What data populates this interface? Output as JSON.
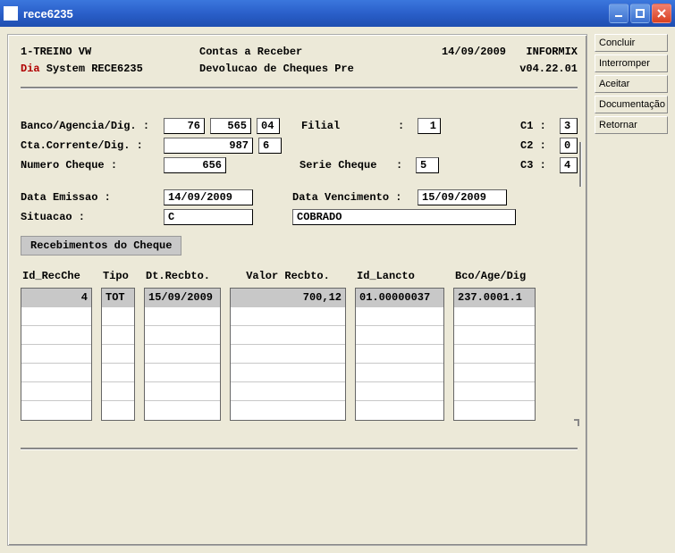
{
  "window": {
    "title": "rece6235"
  },
  "sideButtons": {
    "concluir": "Concluir",
    "interromper": "Interromper",
    "aceitar": "Aceitar",
    "documentacao": "Documentação",
    "retornar": "Retornar"
  },
  "header": {
    "line1_left": "1-TREINO VW",
    "line1_mid": "Contas a Receber",
    "line1_date": "14/09/2009",
    "line1_right": "INFORMIX",
    "dia": "Dia",
    "system_prog": " System  RECE6235",
    "line2_mid": "Devolucao de Cheques Pre",
    "version": "v04.22.01"
  },
  "form": {
    "lbl_banco": "Banco/Agencia/Dig. :",
    "banco": "76",
    "agencia": "565",
    "dig": "04",
    "lbl_filial": "Filial",
    "filial": "1",
    "lbl_c1": "C1 :",
    "c1": "3",
    "lbl_cta": "Cta.Corrente/Dig.  :",
    "cta": "987",
    "cta_dig": "6",
    "lbl_c2": "C2 :",
    "c2": "0",
    "lbl_numcheq": "Numero Cheque      :",
    "numcheq": "656",
    "lbl_serie": "Serie Cheque",
    "serie": "5",
    "lbl_c3": "C3 :",
    "c3": "4",
    "lbl_emissao": "Data Emissao       :",
    "emissao": "14/09/2009",
    "lbl_venc": "Data Vencimento  :",
    "venc": "15/09/2009",
    "lbl_situacao": "Situacao           :",
    "situacao_code": "C",
    "situacao_text": "COBRADO"
  },
  "section": {
    "title": "Recebimentos do Cheque"
  },
  "table": {
    "headers": {
      "id": "Id_RecChe",
      "tipo": "Tipo",
      "dtrec": "Dt.Recbto.",
      "valor": "Valor Recbto.",
      "lancto": "Id_Lancto",
      "bco": "Bco/Age/Dig"
    },
    "row1": {
      "id": "4",
      "tipo": "TOT",
      "dtrec": "15/09/2009",
      "valor": "700,12",
      "lancto": "01.00000037",
      "bco": "237.0001.1"
    }
  }
}
